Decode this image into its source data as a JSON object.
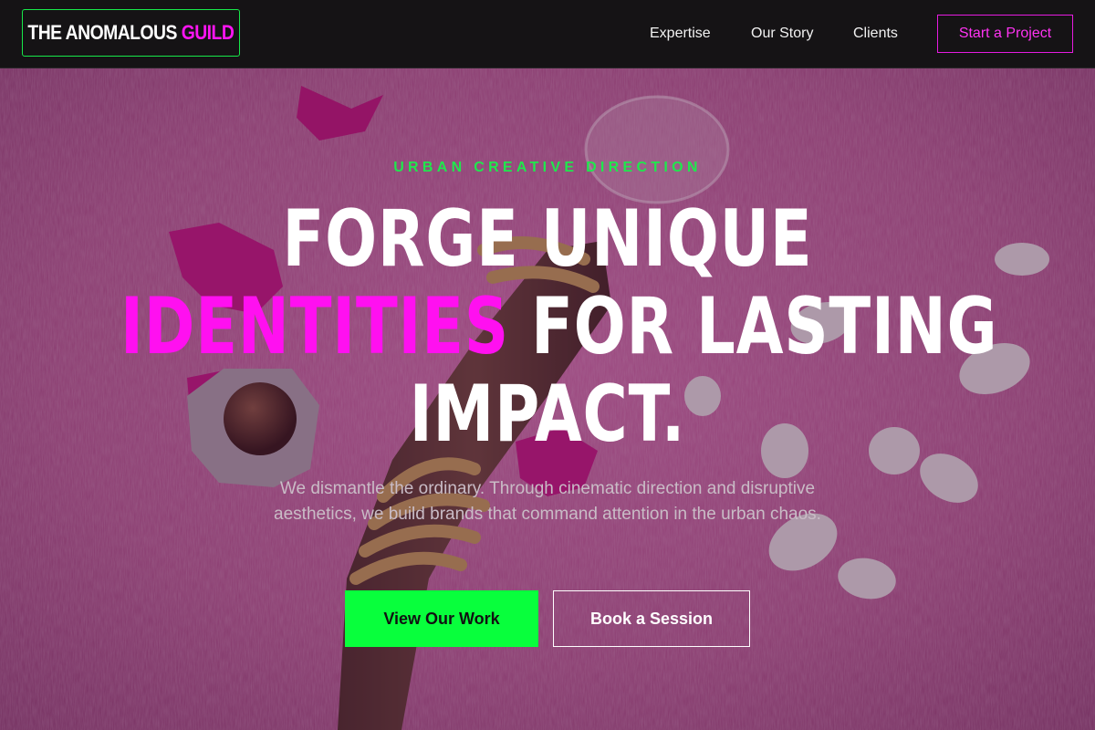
{
  "brand": {
    "logo_primary": "THE ANOMALOUS",
    "logo_accent": "GUILD"
  },
  "nav": {
    "links": [
      "Expertise",
      "Our Story",
      "Clients"
    ],
    "cta": "Start a Project"
  },
  "hero": {
    "eyebrow": "URBAN CREATIVE DIRECTION",
    "headline_line1": "FORGE UNIQUE",
    "headline_accent": "IDENTITIES",
    "headline_line2_rest": "FOR LASTING",
    "headline_line3": "IMPACT.",
    "subtext": "We dismantle the ordinary. Through cinematic direction and disruptive aesthetics, we build brands that command attention in the urban chaos.",
    "primary_button": "View Our Work",
    "secondary_button": "Book a Session"
  },
  "colors": {
    "accent_green": "#08ff3c",
    "accent_magenta": "#ff10f0",
    "nav_background": "#151315"
  }
}
